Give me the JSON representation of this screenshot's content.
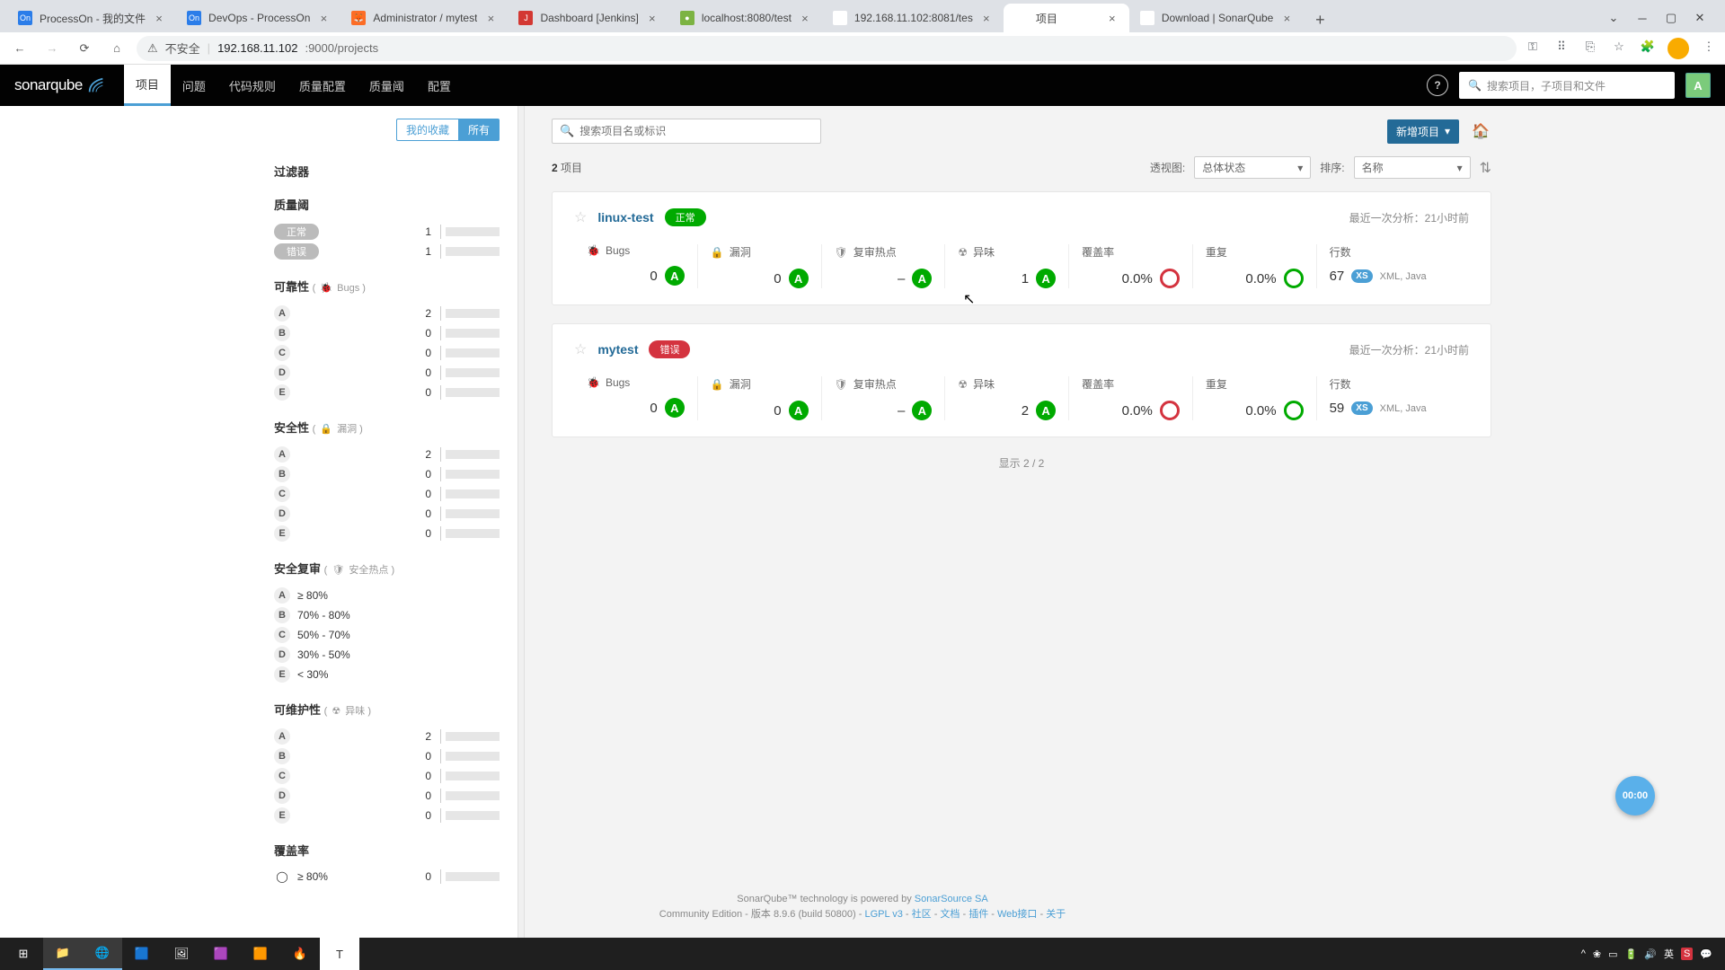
{
  "browser": {
    "tabs": [
      {
        "title": "ProcessOn - 我的文件",
        "favbg": "#2b7de9",
        "favtxt": "On"
      },
      {
        "title": "DevOps - ProcessOn",
        "favbg": "#2b7de9",
        "favtxt": "On"
      },
      {
        "title": "Administrator / mytest",
        "favbg": "#fc6d26",
        "favtxt": "🦊"
      },
      {
        "title": "Dashboard [Jenkins]",
        "favbg": "#d33833",
        "favtxt": "J"
      },
      {
        "title": "localhost:8080/test",
        "favbg": "#7cb342",
        "favtxt": "●"
      },
      {
        "title": "192.168.11.102:8081/tes",
        "favbg": "#fff",
        "favtxt": "○"
      },
      {
        "title": "项目",
        "favbg": "#fff",
        "favtxt": "◐",
        "active": true
      },
      {
        "title": "Download | SonarQube",
        "favbg": "#fff",
        "favtxt": "◐"
      }
    ],
    "url_prefix": "不安全",
    "url_host": "192.168.11.102",
    "url_path": ":9000/projects"
  },
  "nav": {
    "logo": "sonarqube",
    "links": [
      "项目",
      "问题",
      "代码规则",
      "质量配置",
      "质量阈",
      "配置"
    ],
    "active_index": 0,
    "search_placeholder": "搜索项目，子项目和文件",
    "user_initial": "A"
  },
  "sidebar": {
    "fav_tabs": [
      "我的收藏",
      "所有"
    ],
    "fav_active": 1,
    "filters_title": "过滤器",
    "quality_gate": {
      "title": "质量阈",
      "rows": [
        {
          "label": "正常",
          "count": 1,
          "cls": "ok"
        },
        {
          "label": "错误",
          "count": 1,
          "cls": "err"
        }
      ]
    },
    "reliability": {
      "title": "可靠性",
      "sub": "Bugs",
      "icon": "🐞",
      "rows": [
        {
          "r": "A",
          "c": 2
        },
        {
          "r": "B",
          "c": 0
        },
        {
          "r": "C",
          "c": 0
        },
        {
          "r": "D",
          "c": 0
        },
        {
          "r": "E",
          "c": 0
        }
      ]
    },
    "security": {
      "title": "安全性",
      "sub": "漏洞",
      "icon": "🔒",
      "rows": [
        {
          "r": "A",
          "c": 2
        },
        {
          "r": "B",
          "c": 0
        },
        {
          "r": "C",
          "c": 0
        },
        {
          "r": "D",
          "c": 0
        },
        {
          "r": "E",
          "c": 0
        }
      ]
    },
    "review": {
      "title": "安全复审",
      "sub": "安全热点",
      "icon": "🛡",
      "rows": [
        {
          "r": "A",
          "l": "≥ 80%"
        },
        {
          "r": "B",
          "l": "70% - 80%"
        },
        {
          "r": "C",
          "l": "50% - 70%"
        },
        {
          "r": "D",
          "l": "30% - 50%"
        },
        {
          "r": "E",
          "l": "< 30%"
        }
      ]
    },
    "maintain": {
      "title": "可维护性",
      "sub": "异味",
      "icon": "☢",
      "rows": [
        {
          "r": "A",
          "c": 2
        },
        {
          "r": "B",
          "c": 0
        },
        {
          "r": "C",
          "c": 0
        },
        {
          "r": "D",
          "c": 0
        },
        {
          "r": "E",
          "c": 0
        }
      ]
    },
    "coverage": {
      "title": "覆盖率",
      "rows": [
        {
          "l": "≥ 80%",
          "c": 0
        }
      ]
    }
  },
  "main": {
    "search_placeholder": "搜索项目名或标识",
    "new_project": "新增项目",
    "count_num": "2",
    "count_label": "项目",
    "perspective_label": "透视图:",
    "perspective_value": "总体状态",
    "sort_label": "排序:",
    "sort_value": "名称",
    "metric_labels": {
      "bugs": "Bugs",
      "vuln": "漏洞",
      "hotspot": "复审热点",
      "smell": "异味",
      "coverage": "覆盖率",
      "dup": "重复",
      "lines": "行数"
    },
    "projects": [
      {
        "name": "linux-test",
        "qg": "正常",
        "qg_cls": "passed",
        "last": "最近一次分析：",
        "time": "21小时前",
        "bugs": "0",
        "vuln": "0",
        "hotspot": "–",
        "smell": "1",
        "cov": "0.0%",
        "dup": "0.0%",
        "lines": "67",
        "size": "XS",
        "langs": "XML, Java"
      },
      {
        "name": "mytest",
        "qg": "错误",
        "qg_cls": "failed",
        "last": "最近一次分析：",
        "time": "21小时前",
        "bugs": "0",
        "vuln": "0",
        "hotspot": "–",
        "smell": "2",
        "cov": "0.0%",
        "dup": "0.0%",
        "lines": "59",
        "size": "XS",
        "langs": "XML, Java"
      }
    ],
    "footer_count": "显示 2 / 2"
  },
  "footer": {
    "line1a": "SonarQube™ technology is powered by ",
    "line1b": "SonarSource SA",
    "line2_prefix": "Community Edition - 版本 8.9.6 (build 50800) - ",
    "links": [
      "LGPL v3",
      "社区",
      "文档",
      "插件",
      "Web接口",
      "关于"
    ]
  },
  "timer": "00:00"
}
